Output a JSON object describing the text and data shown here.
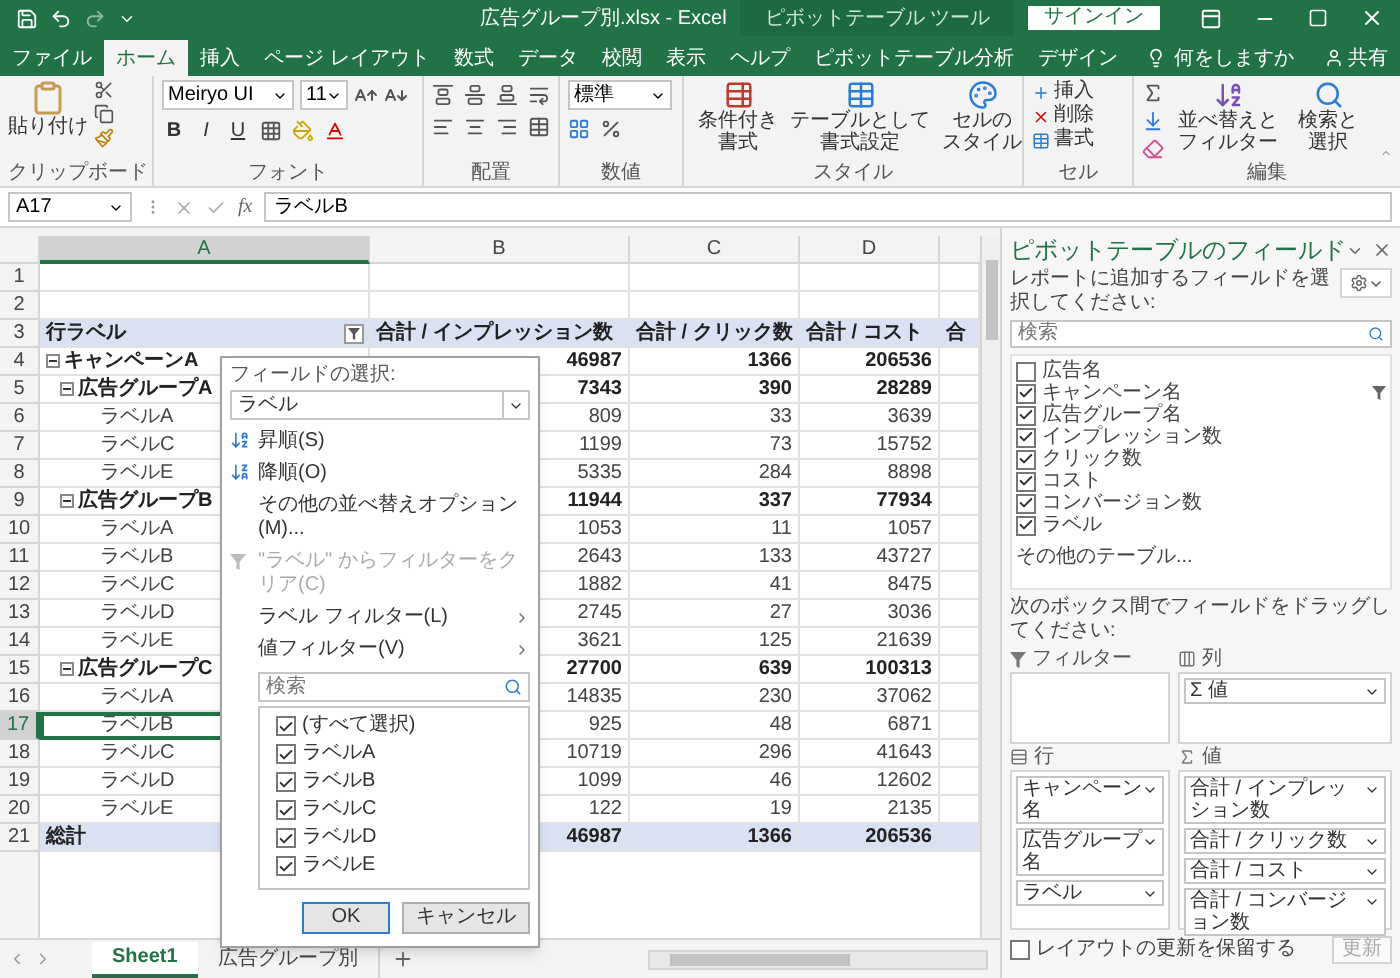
{
  "window": {
    "title": "広告グループ別.xlsx - Excel",
    "context_title": "ピボットテーブル ツール",
    "sign_in": "サインイン"
  },
  "tabs": [
    {
      "label": "ファイル",
      "selected": false
    },
    {
      "label": "ホーム",
      "selected": true
    },
    {
      "label": "挿入",
      "selected": false
    },
    {
      "label": "ページ レイアウト",
      "selected": false
    },
    {
      "label": "数式",
      "selected": false
    },
    {
      "label": "データ",
      "selected": false
    },
    {
      "label": "校閲",
      "selected": false
    },
    {
      "label": "表示",
      "selected": false
    },
    {
      "label": "ヘルプ",
      "selected": false
    },
    {
      "label": "ピボットテーブル分析",
      "selected": false
    },
    {
      "label": "デザイン",
      "selected": false
    }
  ],
  "tell_me": "何をしますか",
  "share": "共有",
  "ribbon": {
    "clipboard": {
      "label": "クリップボード",
      "paste": "貼り付け"
    },
    "font": {
      "label": "フォント",
      "font_name": "Meiryo UI",
      "font_size": "11",
      "styles": [
        "B",
        "I",
        "U"
      ]
    },
    "alignment": {
      "label": "配置"
    },
    "number": {
      "label": "数値",
      "format": "標準"
    },
    "styles": {
      "label": "スタイル",
      "buttons": [
        [
          "条件付き",
          "書式"
        ],
        [
          "テーブルとして",
          "書式設定"
        ],
        [
          "セルの",
          "スタイル"
        ]
      ]
    },
    "cells": {
      "label": "セル",
      "buttons": [
        "挿入",
        "削除",
        "書式"
      ]
    },
    "editing": {
      "label": "編集",
      "buttons": [
        [
          "並べ替えと",
          "フィルター"
        ],
        [
          "検索と",
          "選択"
        ]
      ]
    }
  },
  "formula_bar": {
    "name_box": "A17",
    "fx": "fx",
    "value": "ラベルB"
  },
  "columns": [
    {
      "label": "A",
      "selected": true
    },
    {
      "label": "B",
      "selected": false
    },
    {
      "label": "C",
      "selected": false
    },
    {
      "label": "D",
      "selected": false
    }
  ],
  "rows": [
    {
      "number": "1",
      "kind": "blank",
      "selected": false
    },
    {
      "number": "2",
      "kind": "blank",
      "selected": false
    },
    {
      "number": "3",
      "kind": "header",
      "selected": false,
      "label": "行ラベル",
      "values": [
        "合計 / インプレッション数",
        "合計 / クリック数",
        "合計 / コスト",
        "合"
      ]
    },
    {
      "number": "4",
      "kind": "campaign",
      "selected": false,
      "expanded": true,
      "label": "キャンペーンA",
      "values": [
        "46987",
        "1366",
        "206536"
      ]
    },
    {
      "number": "5",
      "kind": "group",
      "selected": false,
      "expanded": true,
      "label": "広告グループA",
      "values": [
        "7343",
        "390",
        "28289"
      ]
    },
    {
      "number": "6",
      "kind": "label",
      "selected": false,
      "label": "ラベルA",
      "values": [
        "809",
        "33",
        "3639"
      ]
    },
    {
      "number": "7",
      "kind": "label",
      "selected": false,
      "label": "ラベルC",
      "values": [
        "1199",
        "73",
        "15752"
      ]
    },
    {
      "number": "8",
      "kind": "label",
      "selected": false,
      "label": "ラベルE",
      "values": [
        "5335",
        "284",
        "8898"
      ]
    },
    {
      "number": "9",
      "kind": "group",
      "selected": false,
      "expanded": true,
      "label": "広告グループB",
      "values": [
        "11944",
        "337",
        "77934"
      ]
    },
    {
      "number": "10",
      "kind": "label",
      "selected": false,
      "label": "ラベルA",
      "values": [
        "1053",
        "11",
        "1057"
      ]
    },
    {
      "number": "11",
      "kind": "label",
      "selected": false,
      "label": "ラベルB",
      "values": [
        "2643",
        "133",
        "43727"
      ]
    },
    {
      "number": "12",
      "kind": "label",
      "selected": false,
      "label": "ラベルC",
      "values": [
        "1882",
        "41",
        "8475"
      ]
    },
    {
      "number": "13",
      "kind": "label",
      "selected": false,
      "label": "ラベルD",
      "values": [
        "2745",
        "27",
        "3036"
      ]
    },
    {
      "number": "14",
      "kind": "label",
      "selected": false,
      "label": "ラベルE",
      "values": [
        "3621",
        "125",
        "21639"
      ]
    },
    {
      "number": "15",
      "kind": "group",
      "selected": false,
      "expanded": true,
      "label": "広告グループC",
      "values": [
        "27700",
        "639",
        "100313"
      ]
    },
    {
      "number": "16",
      "kind": "label",
      "selected": false,
      "label": "ラベルA",
      "values": [
        "14835",
        "230",
        "37062"
      ]
    },
    {
      "number": "17",
      "kind": "label",
      "selected": true,
      "label": "ラベルB",
      "values": [
        "925",
        "48",
        "6871"
      ]
    },
    {
      "number": "18",
      "kind": "label",
      "selected": false,
      "label": "ラベルC",
      "values": [
        "10719",
        "296",
        "41643"
      ]
    },
    {
      "number": "19",
      "kind": "label",
      "selected": false,
      "label": "ラベルD",
      "values": [
        "1099",
        "46",
        "12602"
      ]
    },
    {
      "number": "20",
      "kind": "label",
      "selected": false,
      "label": "ラベルE",
      "values": [
        "122",
        "19",
        "2135"
      ]
    },
    {
      "number": "21",
      "kind": "total",
      "selected": false,
      "label": "総計",
      "values": [
        "46987",
        "1366",
        "206536"
      ]
    }
  ],
  "filter_popup": {
    "field_label": "フィールドの選択:",
    "field_value": "ラベル",
    "menu": [
      {
        "kind": "sort_asc",
        "text": "昇順(S)",
        "disabled": false
      },
      {
        "kind": "sort_desc",
        "text": "降順(O)",
        "disabled": false
      },
      {
        "kind": "plain",
        "text": "その他の並べ替えオプション(M)...",
        "disabled": false
      },
      {
        "kind": "clear",
        "text": "\"ラベル\" からフィルターをクリア(C)",
        "disabled": true
      },
      {
        "kind": "submenu",
        "text": "ラベル フィルター(L)",
        "disabled": false
      },
      {
        "kind": "submenu",
        "text": "値フィルター(V)",
        "disabled": false
      }
    ],
    "search_placeholder": "検索",
    "items": [
      {
        "text": "(すべて選択)",
        "checked": true
      },
      {
        "text": "ラベルA",
        "checked": true
      },
      {
        "text": "ラベルB",
        "checked": true
      },
      {
        "text": "ラベルC",
        "checked": true
      },
      {
        "text": "ラベルD",
        "checked": true
      },
      {
        "text": "ラベルE",
        "checked": true
      }
    ],
    "buttons": [
      "OK",
      "キャンセル"
    ]
  },
  "sheet_tabs": [
    {
      "label": "Sheet1",
      "selected": true
    },
    {
      "label": "広告グループ別",
      "selected": false
    }
  ],
  "pivot_panel": {
    "title": "ピボットテーブルのフィールド",
    "subtitle": "レポートに追加するフィールドを選択してください:",
    "search_placeholder": "検索",
    "fields": [
      {
        "name": "広告名",
        "checked": false,
        "filtered": false
      },
      {
        "name": "キャンペーン名",
        "checked": true,
        "filtered": true
      },
      {
        "name": "広告グループ名",
        "checked": true,
        "filtered": false
      },
      {
        "name": "インプレッション数",
        "checked": true,
        "filtered": false
      },
      {
        "name": "クリック数",
        "checked": true,
        "filtered": false
      },
      {
        "name": "コスト",
        "checked": true,
        "filtered": false
      },
      {
        "name": "コンバージョン数",
        "checked": true,
        "filtered": false
      },
      {
        "name": "ラベル",
        "checked": true,
        "filtered": false
      }
    ],
    "more_tables": "その他のテーブル...",
    "drag_hint": "次のボックス間でフィールドをドラッグしてください:",
    "areas": [
      {
        "kind": "filters",
        "label": "フィルター"
      },
      {
        "kind": "columns",
        "label": "列",
        "items": [
          "Σ 値"
        ]
      },
      {
        "kind": "rows",
        "label": "行",
        "items": [
          "キャンペーン名",
          "広告グループ名",
          "ラベル"
        ]
      },
      {
        "kind": "values",
        "label": "値",
        "items": [
          "合計 / インプレッション数",
          "合計 / クリック数",
          "合計 / コスト",
          "合計 / コンバージョン数"
        ]
      }
    ],
    "defer": {
      "label": "レイアウトの更新を保留する",
      "checked": false
    },
    "update": {
      "label": "更新",
      "disabled": true
    }
  }
}
